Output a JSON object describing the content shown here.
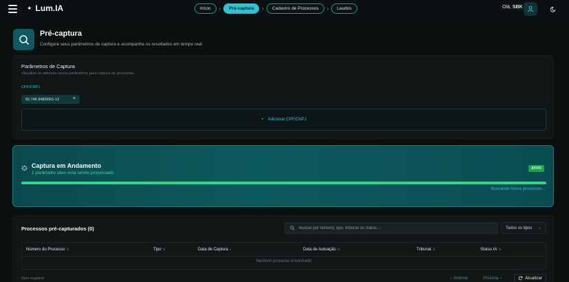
{
  "app": {
    "name": "Lum.IA"
  },
  "nav": {
    "breadcrumbs": [
      {
        "label": "Início",
        "active": false
      },
      {
        "label": "Pré-captura",
        "active": true
      },
      {
        "label": "Cadastro de Processos",
        "active": false
      },
      {
        "label": "Laudos",
        "active": false
      }
    ]
  },
  "user": {
    "greeting_prefix": "Olá, ",
    "name": "SBK"
  },
  "page": {
    "title": "Pré-captura",
    "subtitle": "Configure seus parâmetros de captura e acompanhe os resultados em tempo real"
  },
  "params": {
    "title": "Parâmetros de Captura",
    "subtitle": "Visualize ou adicione novos parâmetros para captura de processos",
    "field_label": "CPF/CNPJ",
    "chips": [
      "60.746.948/0001-12"
    ],
    "add_label": "Adicionar CPF/CNPJ"
  },
  "capture": {
    "title": "Captura em Andamento",
    "subtitle": "1 parâmetro ativo está sendo processado",
    "badge": "ATIVO",
    "progress": 1.0,
    "status": "Buscando novos processos..."
  },
  "results": {
    "title": "Processos pré-capturados (0)",
    "search_placeholder": "Buscar por número, tipo, tribunal ou status...",
    "filter_value": "Todos os tipos",
    "columns": [
      {
        "label": "Número do Processo"
      },
      {
        "label": "Tipo"
      },
      {
        "label": "Data de Captura"
      },
      {
        "label": "Data de Autuação"
      },
      {
        "label": "Tribunal"
      },
      {
        "label": "Status IA"
      }
    ],
    "empty_text": "Nenhum processo encontrado",
    "records_text": "Sem registros",
    "prev_label": "Anterior",
    "next_label": "Próxima",
    "refresh_label": "Atualizar"
  },
  "colors": {
    "accent": "#2ec4cf",
    "success": "#36d68a",
    "badge": "#1ea24a",
    "background": "#0a0f10"
  }
}
